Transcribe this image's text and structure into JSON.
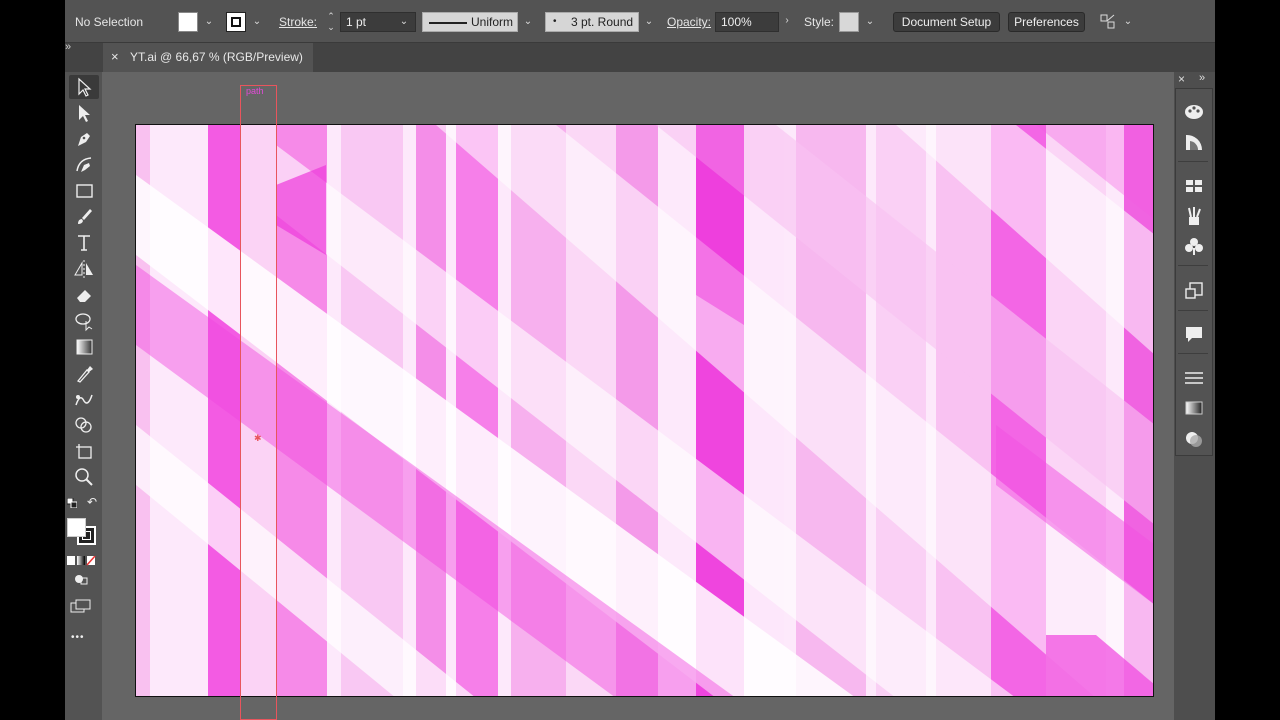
{
  "control_bar": {
    "selection_label": "No Selection",
    "stroke_label": "Stroke:",
    "stroke_weight": "1 pt",
    "stroke_profile": "Uniform",
    "brush_label": "3 pt. Round",
    "opacity_label": "Opacity:",
    "opacity_value": "100%",
    "style_label": "Style:",
    "document_setup": "Document Setup",
    "preferences": "Preferences",
    "fill_color": "#ffffff",
    "style_swatch_color": "#d8d8d8"
  },
  "tab": {
    "title": "YT.ai @ 66,67 % (RGB/Preview)",
    "close_glyph": "×"
  },
  "collapse_glyph": "»",
  "canvas": {
    "smart_guide_label": "path",
    "guide_color": "#e8555d",
    "artboard_colors": [
      "#ffffff",
      "#ee44dd",
      "#f7b0ee"
    ]
  },
  "toolbar": {
    "tools": [
      "selection-tool",
      "direct-selection-tool",
      "pen-tool",
      "curvature-tool",
      "rectangle-tool",
      "paintbrush-tool",
      "type-tool",
      "reflect-tool",
      "eraser-tool",
      "lasso-tool",
      "gradient-tool",
      "eyedropper-tool",
      "blend-tool",
      "shape-builder-tool",
      "artboard-tool",
      "zoom-tool"
    ],
    "more_glyph": "•••"
  },
  "dock": {
    "icons": [
      "color-panel-icon",
      "color-guide-icon",
      "swatches-icon",
      "brushes-icon",
      "symbols-icon",
      "transform-icon",
      "comments-icon",
      "align-icon",
      "gradient-icon",
      "transparency-icon"
    ]
  }
}
